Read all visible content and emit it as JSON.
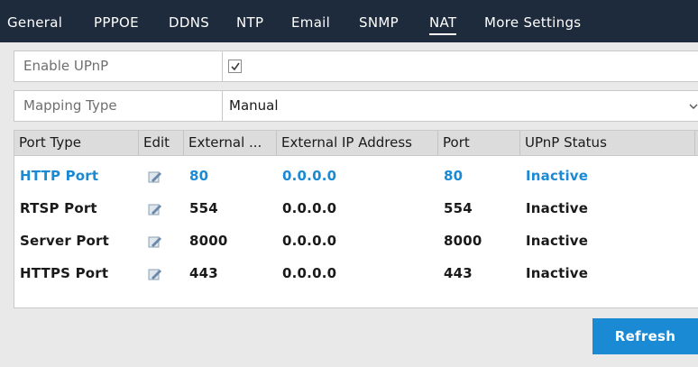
{
  "tabs": [
    {
      "label": "General"
    },
    {
      "label": "PPPOE"
    },
    {
      "label": "DDNS"
    },
    {
      "label": "NTP"
    },
    {
      "label": "Email"
    },
    {
      "label": "SNMP"
    },
    {
      "label": "NAT",
      "active": true
    },
    {
      "label": "More Settings"
    }
  ],
  "settings": {
    "enable_upnp": {
      "label": "Enable UPnP",
      "checked": true
    },
    "mapping_type": {
      "label": "Mapping Type",
      "value": "Manual"
    }
  },
  "table": {
    "columns": [
      "Port Type",
      "Edit",
      "External ...",
      "External IP Address",
      "Port",
      "UPnP Status"
    ],
    "rows": [
      {
        "port_type": "HTTP Port",
        "external": "80",
        "external_ip": "0.0.0.0",
        "port": "80",
        "status": "Inactive",
        "selected": true
      },
      {
        "port_type": "RTSP Port",
        "external": "554",
        "external_ip": "0.0.0.0",
        "port": "554",
        "status": "Inactive"
      },
      {
        "port_type": "Server Port",
        "external": "8000",
        "external_ip": "0.0.0.0",
        "port": "8000",
        "status": "Inactive"
      },
      {
        "port_type": "HTTPS Port",
        "external": "443",
        "external_ip": "0.0.0.0",
        "port": "443",
        "status": "Inactive"
      }
    ]
  },
  "buttons": {
    "refresh": "Refresh"
  },
  "colors": {
    "accent": "#1a8ad4",
    "tabbar": "#1e2b3c",
    "background": "#e9e9e9"
  },
  "icons": {
    "checkbox_check": "check-icon",
    "dropdown": "chevron-down-icon",
    "edit": "edit-icon"
  }
}
